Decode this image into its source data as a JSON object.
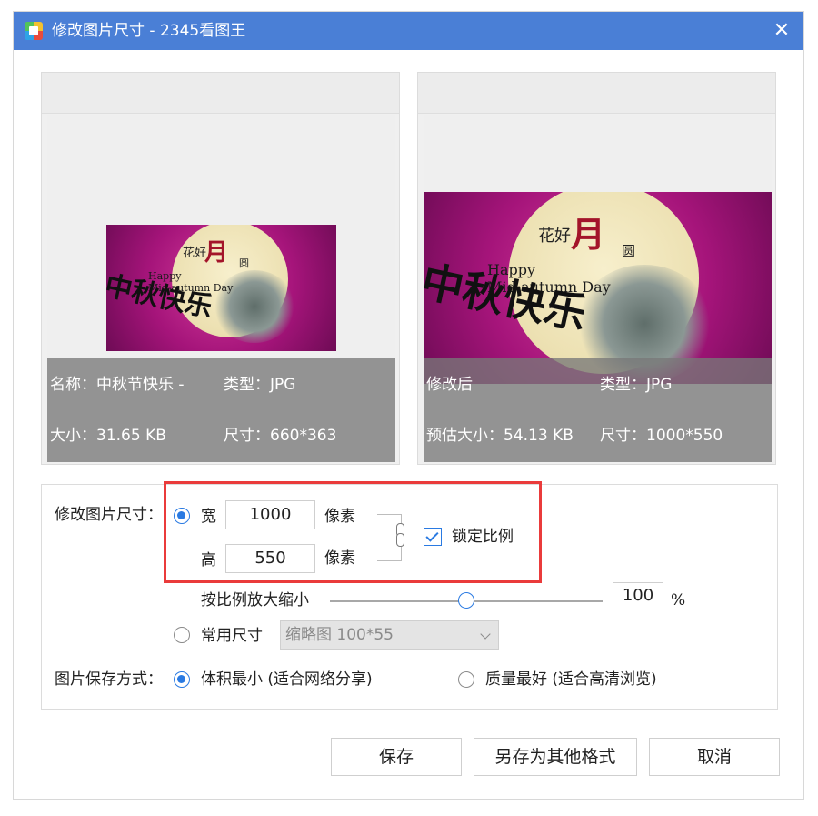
{
  "window": {
    "title": "修改图片尺寸 - 2345看图王",
    "app_icon": "app-logo-icon",
    "close_glyph": "✕"
  },
  "preview_original": {
    "image_text": {
      "big": "中秋快乐",
      "en1": "Happy",
      "en2": "Mid-autumn Day",
      "red": "月",
      "small": "花好",
      "round": "圆"
    },
    "name": "名称：中秋节快乐 -",
    "type": "类型：JPG",
    "size": "大小：31.65 KB",
    "dims": "尺寸：660*363"
  },
  "preview_modified": {
    "image_text": {
      "big": "中秋快乐",
      "en1": "Happy",
      "en2": "Mid-autumn Day",
      "red": "月",
      "small": "花好",
      "round": "圆"
    },
    "name": "修改后",
    "type": "类型：JPG",
    "size": "预估大小：54.13 KB",
    "dims": "尺寸：1000*550"
  },
  "settings": {
    "resize_label": "修改图片尺寸：",
    "width_label": "宽",
    "width_value": "1000",
    "height_label": "高",
    "height_value": "550",
    "unit": "像素",
    "lock_ratio_label": "锁定比例",
    "lock_ratio_checked": true,
    "scale_label": "按比例放大缩小",
    "scale_value": "100",
    "scale_fraction": 0.5,
    "percent": "%",
    "common_size_label": "常用尺寸",
    "common_size_selected": "缩略图 100*55",
    "save_mode_label": "图片保存方式：",
    "option_small": "体积最小 (适合网络分享)",
    "option_quality": "质量最好 (适合高清浏览)",
    "selected_mode": "small"
  },
  "buttons": {
    "save": "保存",
    "save_as": "另存为其他格式",
    "cancel": "取消"
  },
  "colors": {
    "titlebar": "#4a7fd6",
    "accent": "#2a7ae2",
    "highlight": "#ea3b3b",
    "image_bg": "#a5147a"
  }
}
